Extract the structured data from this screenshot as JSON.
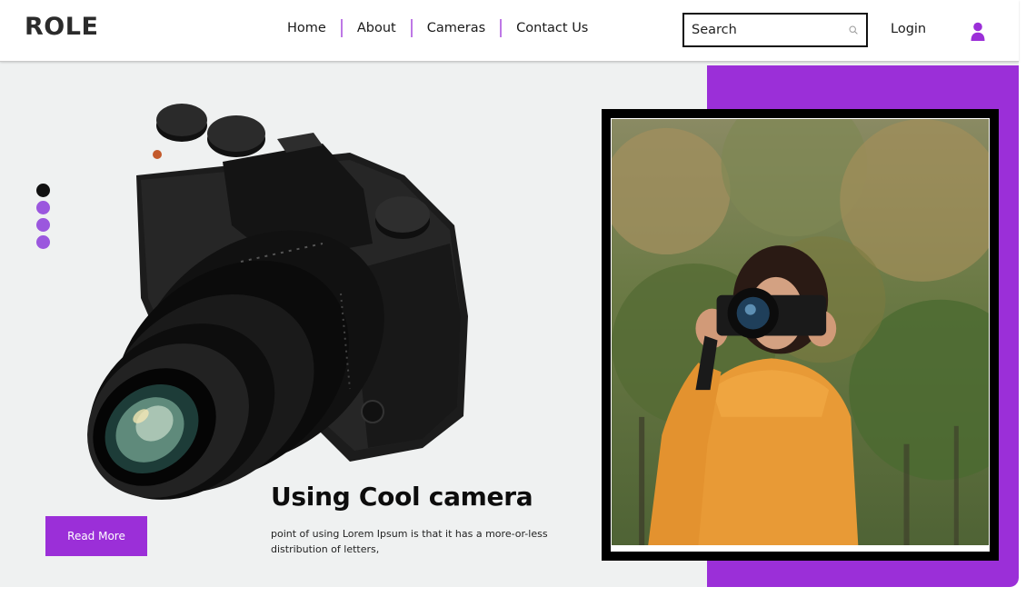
{
  "brand": {
    "logo_text": "ROLE"
  },
  "nav": {
    "items": [
      {
        "label": "Home"
      },
      {
        "label": "About"
      },
      {
        "label": "Cameras"
      },
      {
        "label": "Contact Us"
      }
    ]
  },
  "search": {
    "placeholder": "Search",
    "value": ""
  },
  "header": {
    "login_label": "Login"
  },
  "icons": {
    "search": "search-icon",
    "user": "user-icon"
  },
  "colors": {
    "accent": "#9b2fd8",
    "background": "#eff1f1",
    "dot_inactive": "#9b57de",
    "dot_active": "#111111"
  },
  "hero": {
    "headline": "Using Cool camera",
    "description": "point of using Lorem Ipsum is that it has a more-or-less distribution of letters,",
    "cta_label": "Read More",
    "slider": {
      "count": 4,
      "active_index": 0
    }
  }
}
